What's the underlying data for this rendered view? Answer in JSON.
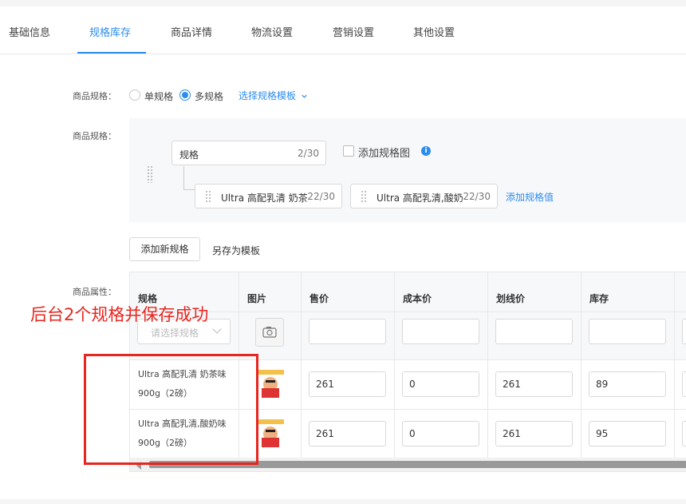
{
  "tabs": [
    "基础信息",
    "规格库存",
    "商品详情",
    "物流设置",
    "营销设置",
    "其他设置"
  ],
  "active_tab": 1,
  "spec_type": {
    "label": "商品规格：",
    "options": [
      "单规格",
      "多规格"
    ],
    "selected": 1,
    "template_link": "选择规格模板"
  },
  "spec_editor": {
    "label": "商品规格：",
    "name_value": "规格",
    "name_count": "2/30",
    "add_image_label": "添加规格图",
    "values": [
      {
        "text": "Ultra 高配乳清 奶茶味",
        "count": "22/30"
      },
      {
        "text": "Ultra 高配乳清,酸奶味",
        "count": "22/30"
      }
    ],
    "add_value_link": "添加规格值"
  },
  "actions": {
    "add_spec": "添加新规格",
    "save_template": "另存为模板"
  },
  "attributes": {
    "label": "商品属性：",
    "columns": [
      "规格",
      "图片",
      "售价",
      "成本价",
      "划线价",
      "库存"
    ],
    "select_placeholder": "请选择规格",
    "rows": [
      {
        "name": "Ultra 高配乳清 奶茶味 900g（2磅）",
        "price": "261",
        "cost": "0",
        "original_price": "261",
        "stock": "89"
      },
      {
        "name": "Ultra 高配乳清,酸奶味 900g（2磅）",
        "price": "261",
        "cost": "0",
        "original_price": "261",
        "stock": "95"
      }
    ]
  },
  "annotation": {
    "text": "后台2个规格并保存成功",
    "color": "#e8251e"
  },
  "colors": {
    "accent": "#2d8cf0"
  }
}
